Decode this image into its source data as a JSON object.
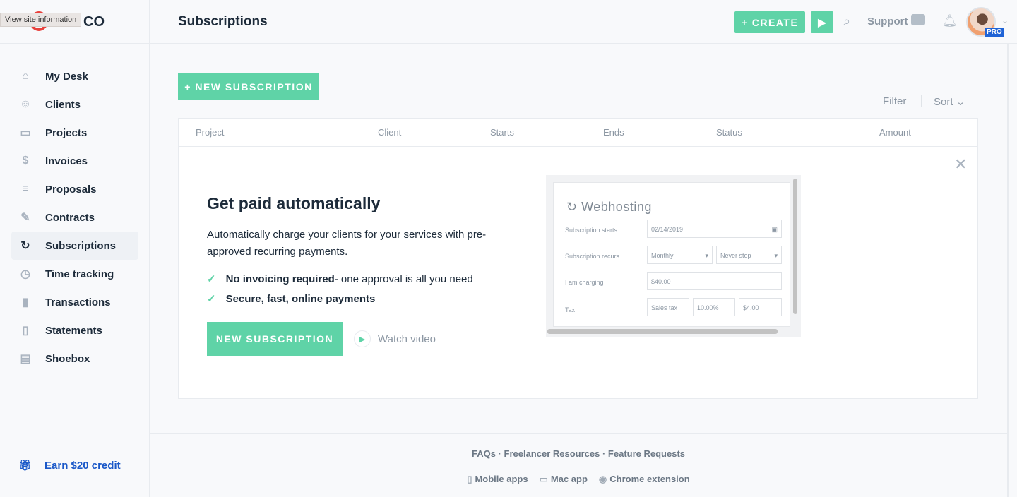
{
  "browser": {
    "tooltip": "View site information"
  },
  "brand": {
    "logo_text": "CO"
  },
  "header": {
    "title": "Subscriptions",
    "create_label": "+ CREATE",
    "support_label": "Support",
    "badge": "PRO"
  },
  "sidebar": {
    "items": [
      {
        "label": "My Desk",
        "icon": "home-icon",
        "glyph": "⌂"
      },
      {
        "label": "Clients",
        "icon": "users-icon",
        "glyph": "☺"
      },
      {
        "label": "Projects",
        "icon": "folder-icon",
        "glyph": "▭"
      },
      {
        "label": "Invoices",
        "icon": "dollar-icon",
        "glyph": "$"
      },
      {
        "label": "Proposals",
        "icon": "document-icon",
        "glyph": "≡"
      },
      {
        "label": "Contracts",
        "icon": "edit-icon",
        "glyph": "✎"
      },
      {
        "label": "Subscriptions",
        "icon": "refresh-icon",
        "glyph": "↻",
        "active": true
      },
      {
        "label": "Time tracking",
        "icon": "clock-icon",
        "glyph": "◷"
      },
      {
        "label": "Transactions",
        "icon": "bar-chart-icon",
        "glyph": "▮"
      },
      {
        "label": "Statements",
        "icon": "book-icon",
        "glyph": "▯"
      },
      {
        "label": "Shoebox",
        "icon": "archive-icon",
        "glyph": "▤"
      }
    ],
    "earn_label": "Earn $20 credit"
  },
  "main": {
    "new_subscription_label": "+ NEW SUBSCRIPTION",
    "filter_label": "Filter",
    "sort_label": "Sort",
    "columns": [
      "Project",
      "Client",
      "Starts",
      "Ends",
      "Status",
      "Amount"
    ],
    "empty": {
      "title": "Get paid automatically",
      "description": "Automatically charge your clients for your services with pre-approved recurring payments.",
      "bullets": [
        {
          "bold": "No invoicing required",
          "rest": " - one approval is all you need"
        },
        {
          "bold": "Secure, fast, online payments",
          "rest": ""
        }
      ],
      "cta_label": "NEW SUBSCRIPTION",
      "watch_label": "Watch video"
    },
    "preview": {
      "title": "Webhosting",
      "starts_label": "Subscription starts",
      "starts_value": "02/14/2019",
      "recurs_label": "Subscription recurs",
      "recurs_value": "Monthly",
      "end_value": "Never stop",
      "charging_label": "I am charging",
      "charging_value": "$40.00",
      "tax_label": "Tax",
      "tax_name": "Sales tax",
      "tax_rate": "10.00%",
      "tax_amount": "$4.00"
    }
  },
  "footer": {
    "links": [
      "FAQs",
      "Freelancer Resources",
      "Feature Requests"
    ],
    "apps": [
      "Mobile apps",
      "Mac app",
      "Chrome extension"
    ]
  },
  "colors": {
    "accent": "#5fd3a7",
    "brand_red": "#e8413c",
    "link_blue": "#1a58c8",
    "pro_badge": "#1f63d6"
  }
}
